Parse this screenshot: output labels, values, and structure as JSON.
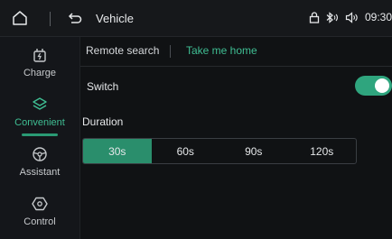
{
  "header": {
    "title": "Vehicle",
    "time": "09:30",
    "status_icons": [
      "lock-icon",
      "bluetooth-icon",
      "volume-icon"
    ]
  },
  "sidebar": {
    "items": [
      {
        "label": "Charge",
        "icon": "charge-icon"
      },
      {
        "label": "Convenient",
        "icon": "convenient-icon",
        "active": true
      },
      {
        "label": "Assistant",
        "icon": "steering-wheel-icon"
      },
      {
        "label": "Control",
        "icon": "control-icon"
      }
    ]
  },
  "tabs": [
    {
      "label": "Remote search"
    },
    {
      "label": "Take me home",
      "active": true
    }
  ],
  "settings": {
    "switch_label": "Switch",
    "switch_on": true,
    "duration_label": "Duration",
    "duration_options": [
      "30s",
      "60s",
      "90s",
      "120s"
    ],
    "duration_selected": "30s"
  },
  "colors": {
    "accent": "#3fbe93",
    "toggle_on": "#2fa57e",
    "segment_selected": "#2a8e6c",
    "background": "#101214"
  }
}
